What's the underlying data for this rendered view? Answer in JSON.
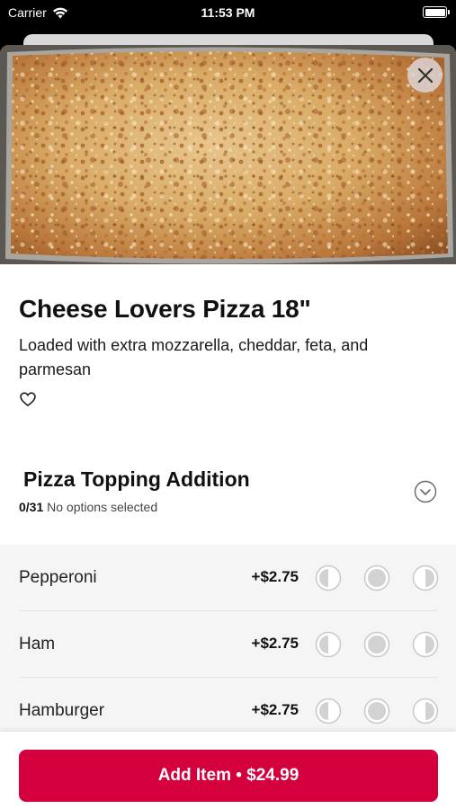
{
  "status_bar": {
    "carrier": "Carrier",
    "time": "11:53 PM",
    "battery_level": 1.0
  },
  "item": {
    "title": "Cheese Lovers Pizza 18\"",
    "description": "Loaded with extra mozzarella, cheddar, feta, and parmesan",
    "favorite_icon": "heart-outline-icon",
    "close_icon": "close-icon"
  },
  "option_group": {
    "title": "Pizza Topping Addition",
    "count": "0/31",
    "status": "No options selected",
    "expand_icon": "chevron-down-circle-icon"
  },
  "options": [
    {
      "name": "Pepperoni",
      "price": "+$2.75"
    },
    {
      "name": "Ham",
      "price": "+$2.75"
    },
    {
      "name": "Hamburger",
      "price": "+$2.75"
    }
  ],
  "placement_icons": [
    "left-half-icon",
    "whole-icon",
    "right-half-icon"
  ],
  "footer": {
    "add_label": "Add Item • $24.99"
  },
  "colors": {
    "accent": "#d3003d",
    "options_bg": "#f5f5f5"
  }
}
